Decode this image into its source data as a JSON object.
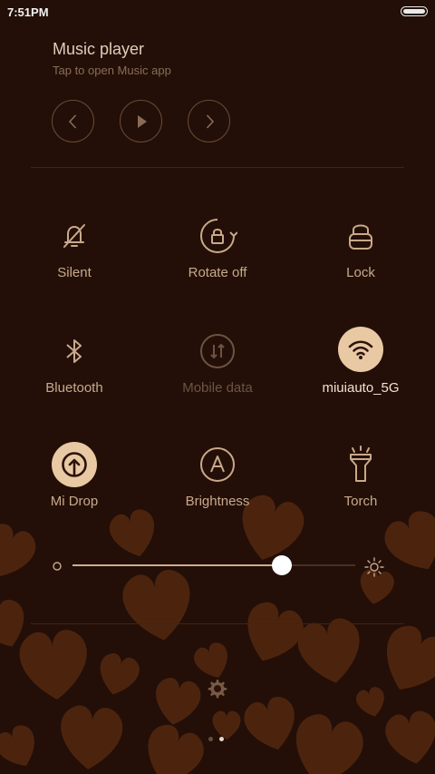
{
  "status_bar": {
    "time": "7:51PM",
    "battery_level": 1.0
  },
  "music": {
    "title": "Music player",
    "subtitle": "Tap to open Music app",
    "controls": {
      "previous_icon": "chevron-left-icon",
      "play_icon": "play-icon",
      "next_icon": "chevron-right-icon"
    }
  },
  "toggles": [
    {
      "label": "Silent",
      "icon": "bell-off-icon",
      "state": "off"
    },
    {
      "label": "Rotate off",
      "icon": "rotate-lock-icon",
      "state": "off"
    },
    {
      "label": "Lock",
      "icon": "lock-icon",
      "state": "off"
    },
    {
      "label": "Bluetooth",
      "icon": "bluetooth-icon",
      "state": "off"
    },
    {
      "label": "Mobile data",
      "icon": "mobile-data-icon",
      "state": "disabled"
    },
    {
      "label": "miuiauto_5G",
      "icon": "wifi-icon",
      "state": "on"
    },
    {
      "label": "Mi Drop",
      "icon": "mi-drop-icon",
      "state": "on"
    },
    {
      "label": "Brightness",
      "icon": "auto-brightness-icon",
      "state": "off"
    },
    {
      "label": "Torch",
      "icon": "torch-icon",
      "state": "off"
    }
  ],
  "brightness": {
    "level": 0.74,
    "min_icon": "brightness-low-icon",
    "max_icon": "brightness-high-icon"
  },
  "settings": {
    "icon": "gear-icon"
  },
  "pager": {
    "count": 2,
    "active_index": 1
  },
  "colors": {
    "background": "#230f08",
    "accent": "#e8c9a3",
    "text": "#c9a98a",
    "heart": "#5a2d12"
  }
}
